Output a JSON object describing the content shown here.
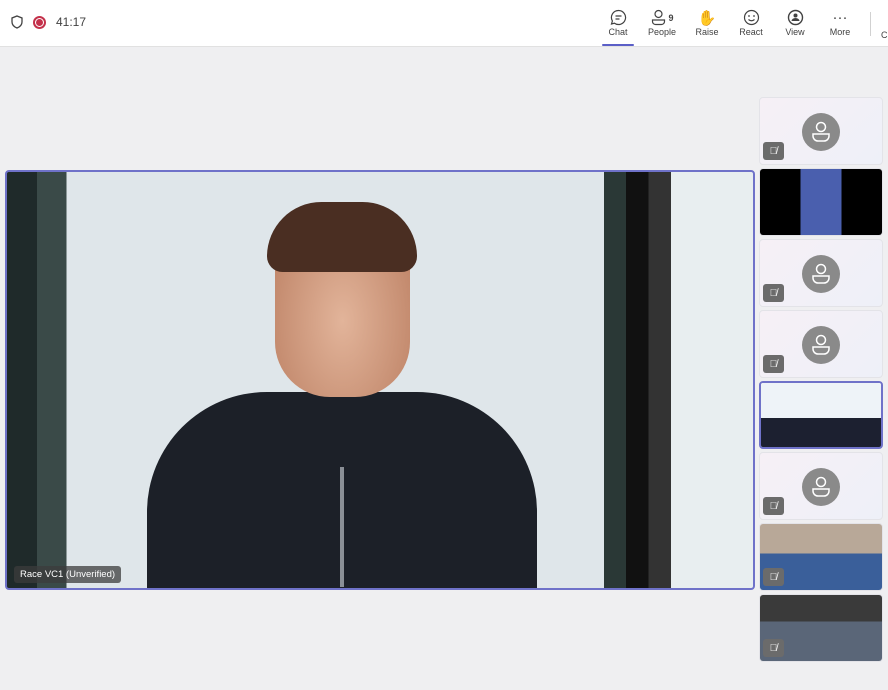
{
  "topbar": {
    "timer": "41:17",
    "buttons": [
      {
        "label": "Chat",
        "icon": "chat-icon",
        "active": true
      },
      {
        "label": "People",
        "icon": "people-icon",
        "badge": "9"
      },
      {
        "label": "Raise",
        "icon": "raise-hand-icon"
      },
      {
        "label": "React",
        "icon": "react-smiley-icon"
      },
      {
        "label": "View",
        "icon": "view-icon"
      },
      {
        "label": "More",
        "icon": "more-icon"
      }
    ],
    "cut_label": "C"
  },
  "main_video": {
    "name_tag": "Race VC1 (Unverified)"
  },
  "accent": "#6f72c9",
  "tiles": [
    {
      "type": "avatar",
      "muted": true
    },
    {
      "type": "video",
      "muted": false
    },
    {
      "type": "avatar",
      "muted": true
    },
    {
      "type": "avatar",
      "muted": true
    },
    {
      "type": "video",
      "muted": false,
      "selected": true
    },
    {
      "type": "avatar",
      "muted": true
    },
    {
      "type": "video",
      "muted": true
    },
    {
      "type": "video",
      "muted": true
    }
  ]
}
